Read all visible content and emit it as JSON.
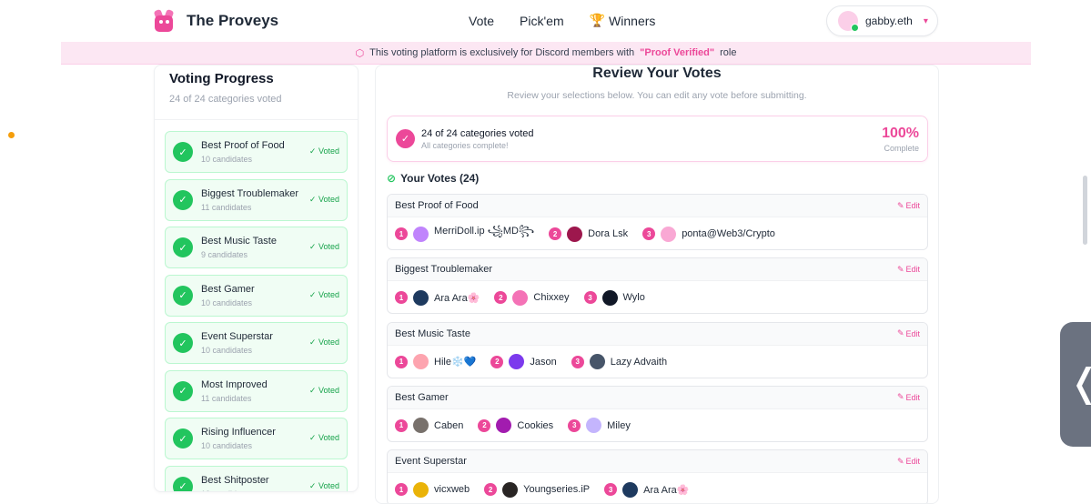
{
  "header": {
    "brand": "The Proveys",
    "nav": [
      "Vote",
      "Pick'em",
      "Winners"
    ],
    "user": "gabby.eth"
  },
  "banner": {
    "prefix": "This voting platform is exclusively for Discord members with",
    "highlight": "\"Proof Verified\"",
    "suffix": "role"
  },
  "progress": {
    "title": "Voting Progress",
    "subtitle": "24 of 24 categories voted",
    "voted_label": "✓ Voted",
    "categories": [
      {
        "name": "Best Proof of Food",
        "count": "10 candidates"
      },
      {
        "name": "Biggest Troublemaker",
        "count": "11 candidates"
      },
      {
        "name": "Best Music Taste",
        "count": "9 candidates"
      },
      {
        "name": "Best Gamer",
        "count": "10 candidates"
      },
      {
        "name": "Event Superstar",
        "count": "10 candidates"
      },
      {
        "name": "Most Improved",
        "count": "11 candidates"
      },
      {
        "name": "Rising Influencer",
        "count": "10 candidates"
      },
      {
        "name": "Best Shitposter",
        "count": "10 candidates"
      }
    ]
  },
  "review": {
    "title": "Review Your Votes",
    "subtitle": "Review your selections below. You can edit any vote before submitting.",
    "summary_main": "24 of 24 categories voted",
    "summary_sub": "All categories complete!",
    "percent": "100%",
    "percent_label": "Complete",
    "your_votes": "Your Votes (24)",
    "edit_label": "Edit",
    "votes": [
      {
        "category": "Best Proof of Food",
        "picks": [
          {
            "rank": "1",
            "name": "MerriDoll.ip ꧁MD꧂",
            "color": "#c084fc"
          },
          {
            "rank": "2",
            "name": "Dora Lsk",
            "color": "#9d174d"
          },
          {
            "rank": "3",
            "name": "ponta@Web3/Crypto",
            "color": "#f9a8d4"
          }
        ]
      },
      {
        "category": "Biggest Troublemaker",
        "picks": [
          {
            "rank": "1",
            "name": "Ara Ara🌸",
            "color": "#1e3a5f"
          },
          {
            "rank": "2",
            "name": "Chixxey",
            "color": "#f472b6"
          },
          {
            "rank": "3",
            "name": "Wylo",
            "color": "#111827"
          }
        ]
      },
      {
        "category": "Best Music Taste",
        "picks": [
          {
            "rank": "1",
            "name": "Hile❄️💙",
            "color": "#fda4af"
          },
          {
            "rank": "2",
            "name": "Jason",
            "color": "#7c3aed"
          },
          {
            "rank": "3",
            "name": "Lazy Advaith",
            "color": "#475569"
          }
        ]
      },
      {
        "category": "Best Gamer",
        "picks": [
          {
            "rank": "1",
            "name": "Caben",
            "color": "#78716c"
          },
          {
            "rank": "2",
            "name": "Cookies",
            "color": "#a21caf"
          },
          {
            "rank": "3",
            "name": "Miley",
            "color": "#c4b5fd"
          }
        ]
      },
      {
        "category": "Event Superstar",
        "picks": [
          {
            "rank": "1",
            "name": "vicxweb",
            "color": "#eab308"
          },
          {
            "rank": "2",
            "name": "Youngseries.iP",
            "color": "#292524"
          },
          {
            "rank": "3",
            "name": "Ara Ara🌸",
            "color": "#1e3a5f"
          }
        ]
      }
    ]
  },
  "colors": {
    "accent": "#ec4899",
    "success": "#22c55e"
  }
}
